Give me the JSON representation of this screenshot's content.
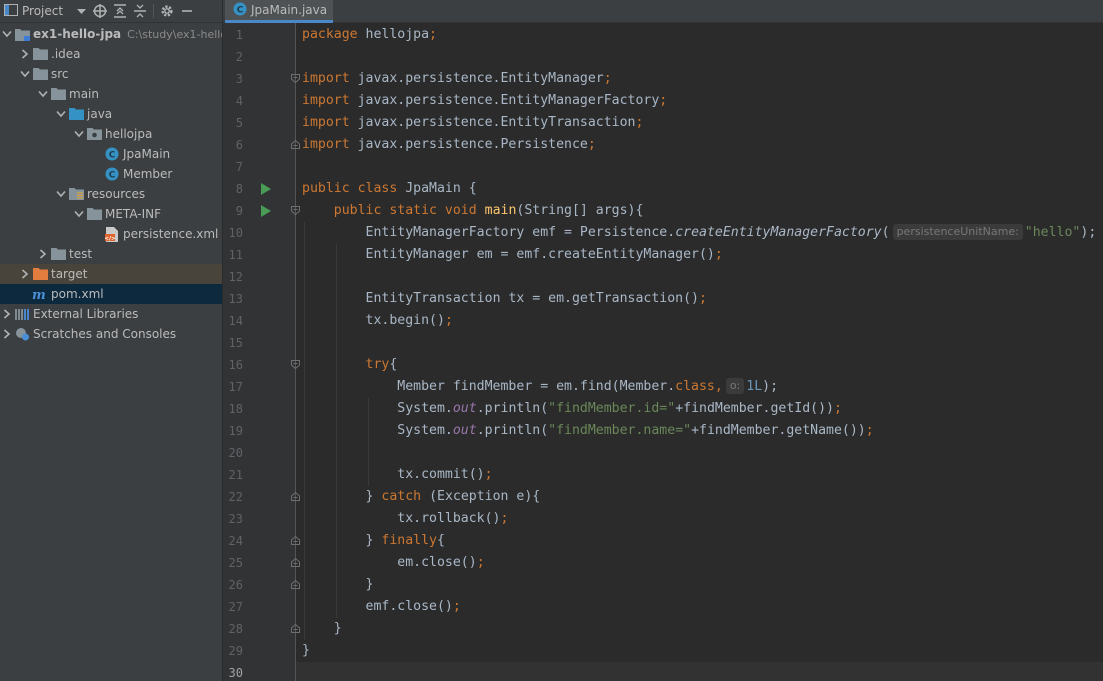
{
  "project_panel": {
    "title": "Project",
    "tree": [
      {
        "label": "ex1-hello-jpa",
        "hint": "C:\\study\\ex1-hello",
        "icon": "module-folder-icon",
        "depth": 0,
        "expanded": true,
        "bold": true
      },
      {
        "label": ".idea",
        "icon": "folder-icon",
        "depth": 1,
        "expanded": false
      },
      {
        "label": "src",
        "icon": "folder-icon",
        "depth": 1,
        "expanded": true
      },
      {
        "label": "main",
        "icon": "folder-icon",
        "depth": 2,
        "expanded": true
      },
      {
        "label": "java",
        "icon": "source-folder-icon",
        "depth": 3,
        "expanded": true
      },
      {
        "label": "hellojpa",
        "icon": "package-icon",
        "depth": 4,
        "expanded": true
      },
      {
        "label": "JpaMain",
        "icon": "class-icon",
        "depth": 5,
        "leaf": true
      },
      {
        "label": "Member",
        "icon": "class-icon",
        "depth": 5,
        "leaf": true
      },
      {
        "label": "resources",
        "icon": "resources-folder-icon",
        "depth": 3,
        "expanded": true
      },
      {
        "label": "META-INF",
        "icon": "folder-icon",
        "depth": 4,
        "expanded": true
      },
      {
        "label": "persistence.xml",
        "icon": "xml-file-icon",
        "depth": 5,
        "leaf": true
      },
      {
        "label": "test",
        "icon": "folder-icon",
        "depth": 2,
        "expanded": false
      },
      {
        "label": "target",
        "icon": "excluded-folder-icon",
        "depth": 1,
        "expanded": false,
        "highlight": true
      },
      {
        "label": "pom.xml",
        "icon": "maven-icon",
        "depth": 1,
        "leaf": true,
        "selected": true
      },
      {
        "label": "External Libraries",
        "icon": "libraries-icon",
        "depth": 0,
        "expanded": false
      },
      {
        "label": "Scratches and Consoles",
        "icon": "scratches-icon",
        "depth": 0,
        "expanded": false
      }
    ]
  },
  "editor": {
    "tab_label": "JpaMain.java",
    "param_hints": {
      "persistence_unit": "persistenceUnitName:",
      "o": "o:"
    },
    "line_numbers": [
      "1",
      "2",
      "3",
      "4",
      "5",
      "6",
      "7",
      "8",
      "9",
      "10",
      "11",
      "12",
      "13",
      "14",
      "15",
      "16",
      "17",
      "18",
      "19",
      "20",
      "21",
      "22",
      "23",
      "24",
      "25",
      "26",
      "27",
      "28",
      "29",
      "30"
    ],
    "current_line": 30,
    "code": {
      "l1_pkg_kw": "package",
      "l1_pkg": " hellojpa",
      "l1_semi": ";",
      "l3_kw": "import",
      "l3": " javax.persistence.EntityManager",
      "l3_semi": ";",
      "l4_kw": "import",
      "l4": " javax.persistence.EntityManagerFactory",
      "l4_semi": ";",
      "l5_kw": "import",
      "l5": " javax.persistence.EntityTransaction",
      "l5_semi": ";",
      "l6_kw": "import",
      "l6": " javax.persistence.Persistence",
      "l6_semi": ";",
      "l8_kw": "public class",
      "l8": " JpaMain {",
      "l9_kw": "public static void",
      "l9_fn": "main",
      "l9": "(String[] args){",
      "l10_a": "EntityManagerFactory emf = Persistence.",
      "l10_fn": "createEntityManagerFactory",
      "l10_b": "(",
      "l10_str": "\"hello\"",
      "l10_end": ");",
      "l11_a": "EntityManager em = emf.createEntityManager()",
      "l11_semi": ";",
      "l13_a": "EntityTransaction tx = em.getTransaction()",
      "l13_semi": ";",
      "l14_a": "tx.begin()",
      "l14_semi": ";",
      "l16_kw": "try",
      "l16": "{",
      "l17_a": "Member findMember = em.find(Member.",
      "l17_kw": "class",
      "l17_comma": ",",
      "l17_num": "1L",
      "l17_end": ");",
      "l18_a": "System.",
      "l18_out": "out",
      "l18_b": ".println(",
      "l18_str": "\"findMember.id=\"",
      "l18_c": "+findMember.getId())",
      "l18_semi": ";",
      "l19_a": "System.",
      "l19_out": "out",
      "l19_b": ".println(",
      "l19_str": "\"findMember.name=\"",
      "l19_c": "+findMember.getName())",
      "l19_semi": ";",
      "l21_a": "tx.commit()",
      "l21_semi": ";",
      "l22_a": "} ",
      "l22_kw": "catch",
      "l22_b": " (Exception e){",
      "l23_a": "tx.rollback()",
      "l23_semi": ";",
      "l24_a": "} ",
      "l24_kw": "finally",
      "l24_b": "{",
      "l25_a": "em.close()",
      "l25_semi": ";",
      "l26_a": "}",
      "l27_a": "emf.close()",
      "l27_semi": ";",
      "l28_a": "}",
      "l29_a": "}"
    }
  },
  "colors": {
    "keyword": "#cc7832",
    "string": "#6a8759",
    "method_decl": "#ffc66d",
    "number": "#6897bb",
    "static_field": "#9876aa",
    "selection": "#0d293e",
    "tab_underline": "#4a88c7"
  }
}
